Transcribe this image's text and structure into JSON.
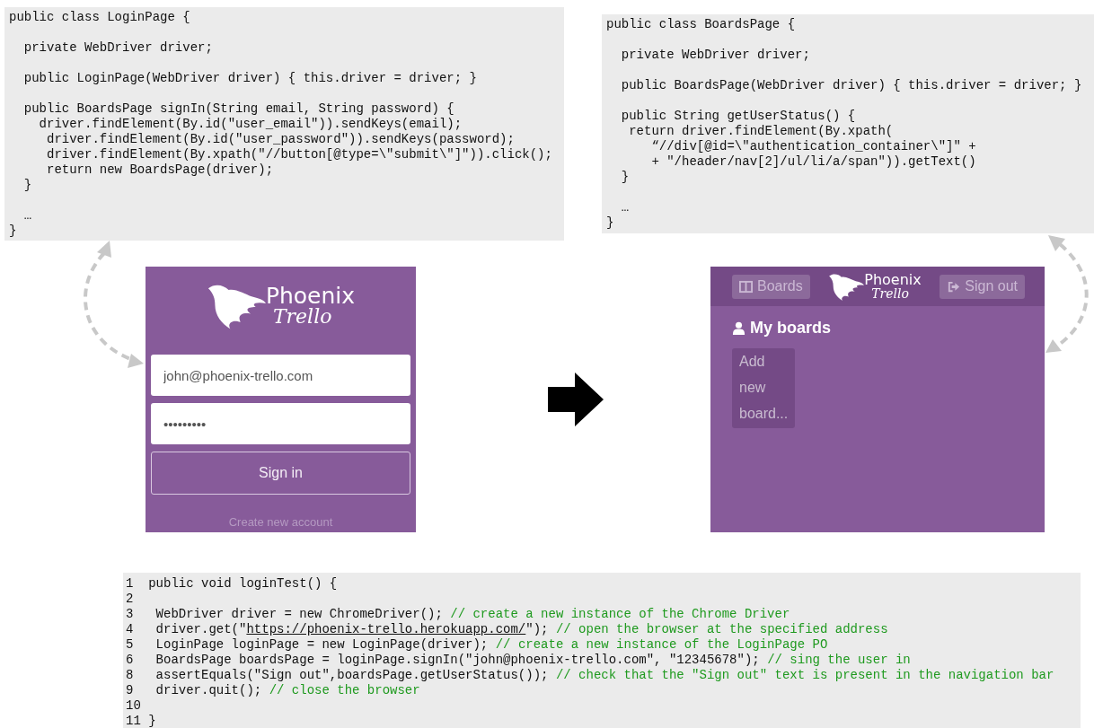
{
  "login_page_code": {
    "code": "public class LoginPage {\n\n  private WebDriver driver;\n\n  public LoginPage(WebDriver driver) { this.driver = driver; }\n\n  public BoardsPage signIn(String email, String password) {\n    driver.findElement(By.id(\"user_email\")).sendKeys(email);\n     driver.findElement(By.id(\"user_password\")).sendKeys(password);\n     driver.findElement(By.xpath(\"//button[@type=\\\"submit\\\"]\")).click();\n     return new BoardsPage(driver);\n  }\n\n  …\n}"
  },
  "boards_page_code": {
    "code": "public class BoardsPage {\n\n  private WebDriver driver;\n\n  public BoardsPage(WebDriver driver) { this.driver = driver; }\n\n  public String getUserStatus() {\n   return driver.findElement(By.xpath(\n      “//div[@id=\\\"authentication_container\\\"]\" +\n      + \"/header/nav[2]/ul/li/a/span\")).getText()\n  }\n\n  …\n}"
  },
  "login_screen": {
    "logo": {
      "line_1": "Phoenix",
      "line_2": "Trello"
    },
    "email_field": {
      "value": "john@phoenix-trello.com"
    },
    "password_field": {
      "value": "•••••••••"
    },
    "sign_in_button": "Sign in",
    "create_account_link": "Create new account"
  },
  "boards_screen": {
    "boards_button": "Boards",
    "logo": {
      "line_1": "Phoenix",
      "line_2": "Trello"
    },
    "sign_out_button": "Sign out",
    "heading": "My boards",
    "add_board_card": "Add new board..."
  },
  "test_code": {
    "lines": [
      {
        "number": "1",
        "segments": [
          {
            "kind": "code",
            "text": "public void loginTest() {"
          }
        ]
      },
      {
        "number": "2"
      },
      {
        "number": "3",
        "segments": [
          {
            "kind": "code",
            "text": " WebDriver driver = new ChromeDriver(); "
          },
          {
            "kind": "comment",
            "text": "// create a new instance of the Chrome Driver"
          }
        ]
      },
      {
        "number": "4",
        "segments": [
          {
            "kind": "code",
            "text": " driver.get(\""
          },
          {
            "kind": "link",
            "text": "https://phoenix-trello.herokuapp.com/"
          },
          {
            "kind": "code",
            "text": "\"); "
          },
          {
            "kind": "comment",
            "text": "// open the browser at the specified address"
          }
        ]
      },
      {
        "number": "5",
        "segments": [
          {
            "kind": "code",
            "text": " LoginPage loginPage = new LoginPage(driver); "
          },
          {
            "kind": "comment",
            "text": "// create a new instance of the LoginPage PO"
          }
        ]
      },
      {
        "number": "6",
        "segments": [
          {
            "kind": "code",
            "text": " BoardsPage boardsPage = loginPage.signIn(\"john@phoenix-trello.com\", \"12345678\"); "
          },
          {
            "kind": "comment",
            "text": "// sing the user in"
          }
        ]
      },
      {
        "number": "8",
        "segments": [
          {
            "kind": "code",
            "text": " assertEquals(\"Sign out\",boardsPage.getUserStatus()); "
          },
          {
            "kind": "comment",
            "text": "// check that the \"Sign out\" text is present in the navigation bar"
          }
        ]
      },
      {
        "number": "9",
        "segments": [
          {
            "kind": "code",
            "text": " driver.quit(); "
          },
          {
            "kind": "comment",
            "text": "// close the browser"
          }
        ]
      },
      {
        "number": "10"
      },
      {
        "number": "11",
        "segments": [
          {
            "kind": "code",
            "text": "}"
          }
        ]
      }
    ]
  }
}
